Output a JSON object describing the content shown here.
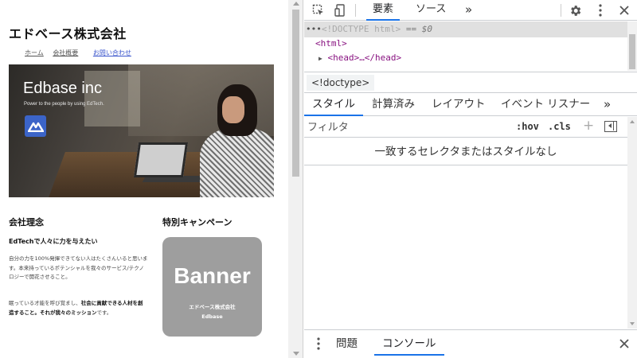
{
  "page": {
    "site_title": "エドベース株式会社",
    "nav": [
      "ホーム",
      "会社概要",
      "お問い合わせ"
    ],
    "hero_heading": "Edbase inc",
    "hero_tagline": "Power to the people by using EdTech.",
    "philosophy": {
      "title": "会社理念",
      "lead": "EdTechで人々に力を与えたい",
      "paragraph1": "自分の力を100%発揮できてない人はたくさんいると思います。本来持っているポテンシャルを我々のサービス/テクノロジーで開花させること。",
      "paragraph2_a": "眠っている才能を呼び覚まし、",
      "paragraph2_b": "社会に貢献できる人材を創造すること。それが我々のミッション",
      "paragraph2_c": "です。"
    },
    "campaign": {
      "title": "特別キャンペーン",
      "banner_title": "Banner",
      "banner_company": "エドベース株式会社",
      "banner_name": "Edbase"
    }
  },
  "devtools": {
    "main_tabs": [
      "要素",
      "ソース"
    ],
    "more_tabs": "»",
    "tree": {
      "selected_prefix": "•••",
      "doctype": "<!DOCTYPE html>",
      "equals": "== $0",
      "html_open": "<html>",
      "head_collapsed": "<head>…</head>"
    },
    "breadcrumb": "<!doctype>",
    "styles_tabs": [
      "スタイル",
      "計算済み",
      "レイアウト",
      "イベント リスナー"
    ],
    "filter_placeholder": "フィルタ",
    "hov": ":hov",
    "cls": ".cls",
    "add": "+",
    "empty_message": "一致するセレクタまたはスタイルなし",
    "drawer_tabs": [
      "問題",
      "コンソール"
    ],
    "close": "✕"
  },
  "colors": {
    "accent": "#1a73e8",
    "tag": "#881280",
    "banner_bg": "#9e9e9e",
    "logo": "#3b64c8"
  }
}
